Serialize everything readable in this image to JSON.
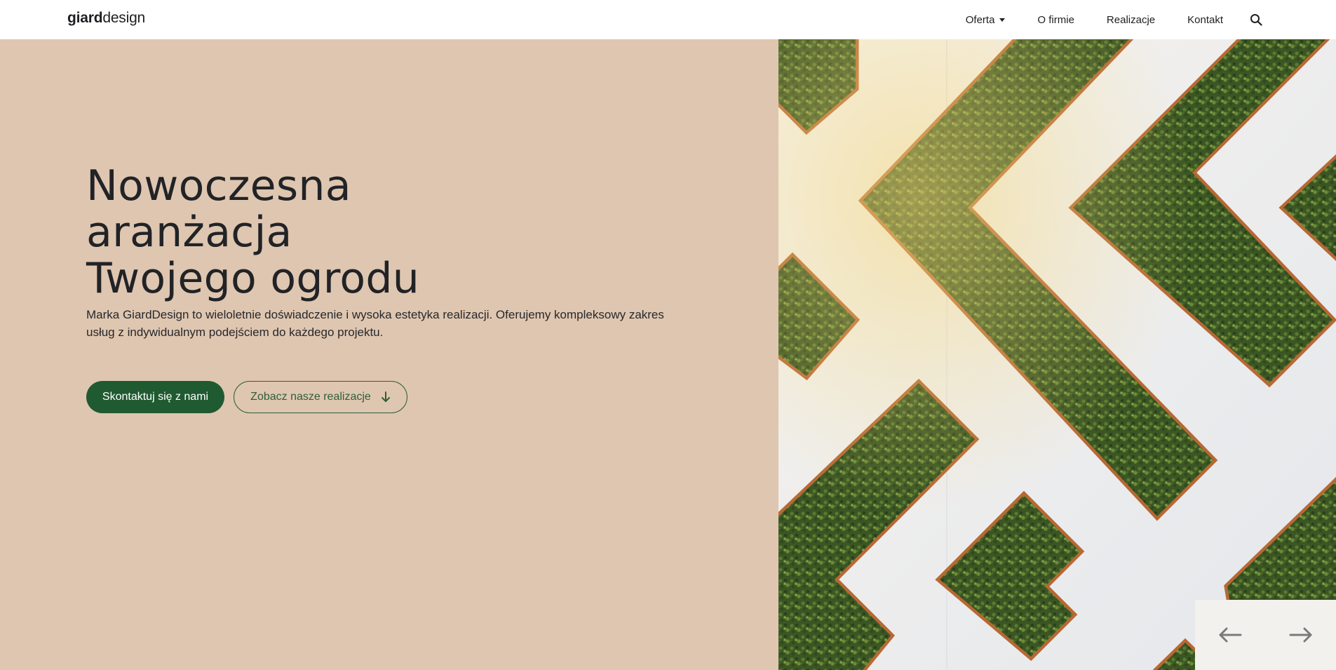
{
  "brand": {
    "bold": "giard",
    "light": "design"
  },
  "nav": {
    "items": [
      {
        "label": "Oferta",
        "dropdown": true
      },
      {
        "label": "O firmie"
      },
      {
        "label": "Realizacje"
      },
      {
        "label": "Kontakt"
      }
    ],
    "search_icon": "search-icon"
  },
  "hero": {
    "title_lines": [
      "Nowoczesna",
      "aranżacja",
      "Twojego ogrodu"
    ],
    "description": "Marka GiardDesign to wieloletnie doświadczenie i wysoka estetyka realizacji. Oferujemy kompleksowy zakres usług z indywidualnym podejściem do każdego projektu.",
    "primary_button": "Skontaktuj się z nami",
    "secondary_button": "Zobacz nasze realizacje",
    "secondary_icon": "arrow-down-icon"
  },
  "slider": {
    "prev_icon": "arrow-left-icon",
    "next_icon": "arrow-right-icon"
  },
  "colors": {
    "hero_bg": "#dfc6b0",
    "primary_green": "#1f5a31",
    "text_dark": "#212326",
    "planter_wood": "#b8652d",
    "hedge_green": "#3d5a25",
    "wall_white": "#f1f1f2"
  }
}
